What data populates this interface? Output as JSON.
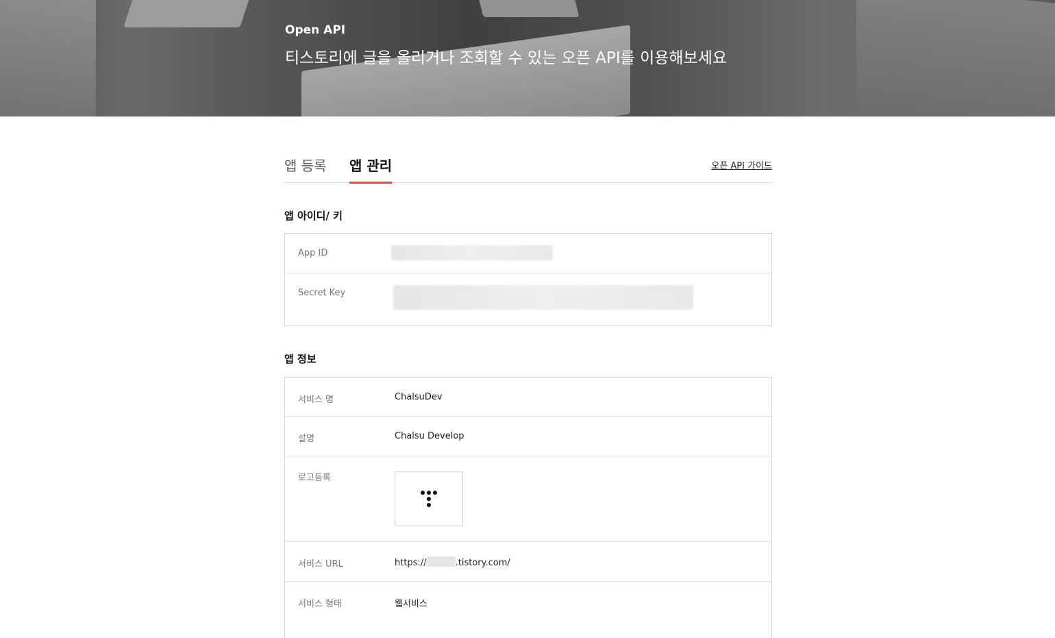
{
  "hero": {
    "title": "Open API",
    "subtitle": "티스토리에 글을 올리거나 조회할 수 있는 오픈 API를 이용해보세요"
  },
  "tabs": [
    {
      "label": "앱 등록",
      "active": false
    },
    {
      "label": "앱 관리",
      "active": true
    }
  ],
  "guide_link": "오픈 API 가이드",
  "app_keys": {
    "section_title": "앱 아이디/ 키",
    "rows": [
      {
        "label": "App ID",
        "value_hidden": true
      },
      {
        "label": "Secret Key",
        "value_hidden": true
      }
    ]
  },
  "app_info": {
    "section_title": "앱 정보",
    "rows": [
      {
        "label": "서비스 명",
        "value": "ChalsuDev"
      },
      {
        "label": "설명",
        "value": "Chalsu Develop"
      },
      {
        "label": "로고등록",
        "value": ""
      },
      {
        "label": "서비스 URL",
        "value_prefix": "https://",
        "value_suffix": ".tistory.com/"
      },
      {
        "label": "서비스 형태",
        "value": "웹서비스"
      }
    ]
  },
  "colors": {
    "tab_active_underline": "#e8483f"
  }
}
